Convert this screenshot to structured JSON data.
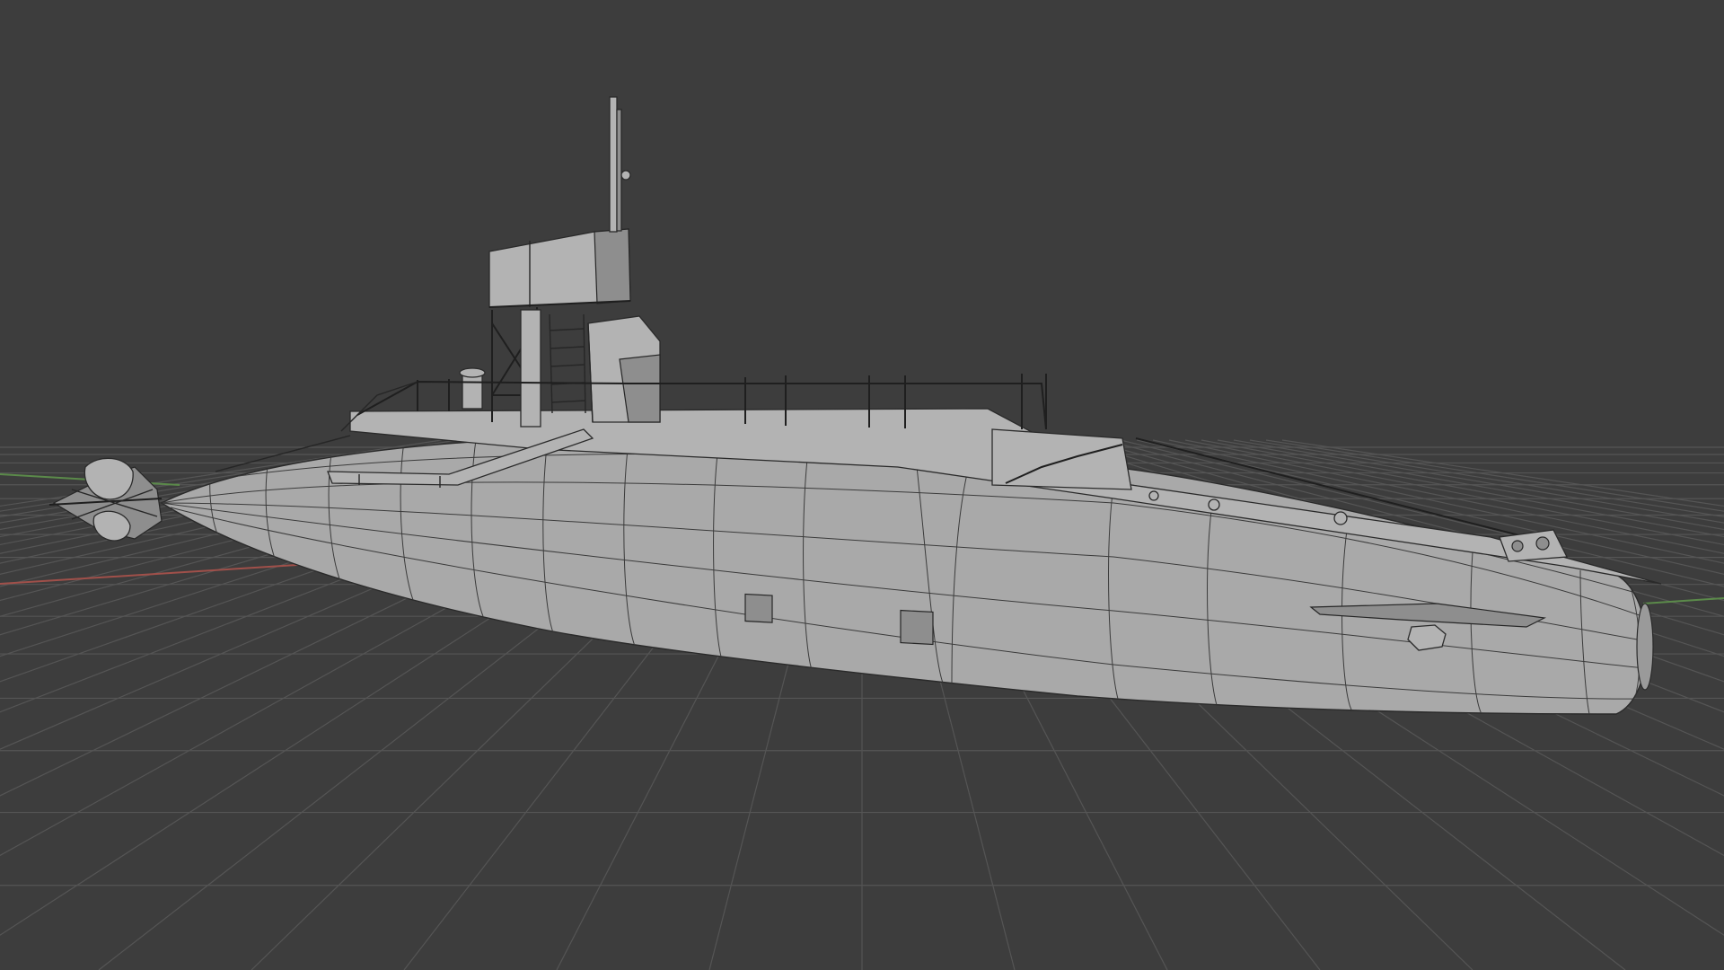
{
  "viewport": {
    "background_color": "#3d3d3d",
    "grid_color": "#555555",
    "axis_x_color": "#a0504a",
    "axis_y_color": "#5b8a4a"
  },
  "model": {
    "shading": "solid-with-wireframe",
    "hull_color": "#a9a9a9",
    "wire_color": "#3b3b3b"
  }
}
